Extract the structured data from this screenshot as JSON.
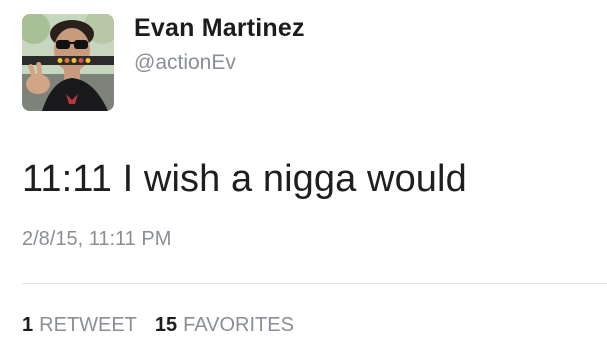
{
  "user": {
    "display_name": "Evan Martinez",
    "handle": "@actionEv"
  },
  "tweet": {
    "text": "11:11 I wish a nigga would",
    "timestamp": "2/8/15, 11:11 PM"
  },
  "stats": {
    "retweets_count": "1",
    "retweets_label": "RETWEET",
    "favorites_count": "15",
    "favorites_label": "FAVORITES"
  },
  "colors": {
    "name": "#1c1c1c",
    "secondary": "#8a8f95",
    "divider": "#e1e4e7",
    "background": "#ffffff"
  }
}
